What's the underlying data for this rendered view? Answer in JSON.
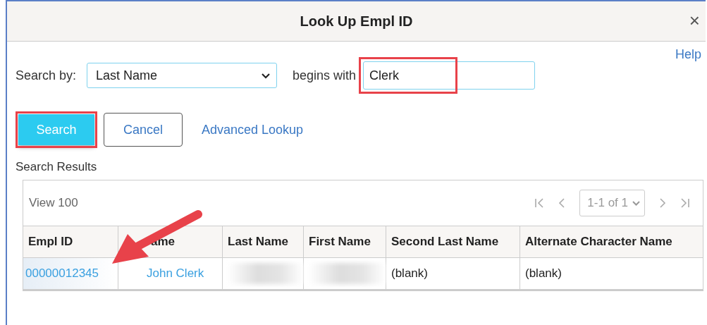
{
  "window": {
    "title": "Look Up Empl ID",
    "close": "×"
  },
  "help": "Help",
  "search": {
    "label": "Search by:",
    "field": "Last Name",
    "operator": "begins with",
    "value": "Clerk",
    "highlighted": true
  },
  "buttons": [
    {
      "label": "Search",
      "kind": "primary",
      "highlighted": true
    },
    {
      "label": "Cancel",
      "kind": "secondary",
      "highlighted": false
    },
    {
      "label": "Advanced Lookup",
      "kind": "link",
      "highlighted": false
    }
  ],
  "results": {
    "title": "Search Results",
    "view": "View 100",
    "pager": "1-1 of 1",
    "columns": [
      "Empl ID",
      "ame",
      "Last Name",
      "First Name",
      "Second Last Name",
      "Alternate Character Name"
    ],
    "rows": [
      [
        {
          "text": "00000012345",
          "kind": "link"
        },
        {
          "text": "John Clerk",
          "kind": "link"
        },
        {
          "kind": "redacted"
        },
        {
          "kind": "redacted"
        },
        {
          "text": "(blank)",
          "kind": "text"
        },
        {
          "text": "(blank)",
          "kind": "text"
        }
      ]
    ]
  }
}
